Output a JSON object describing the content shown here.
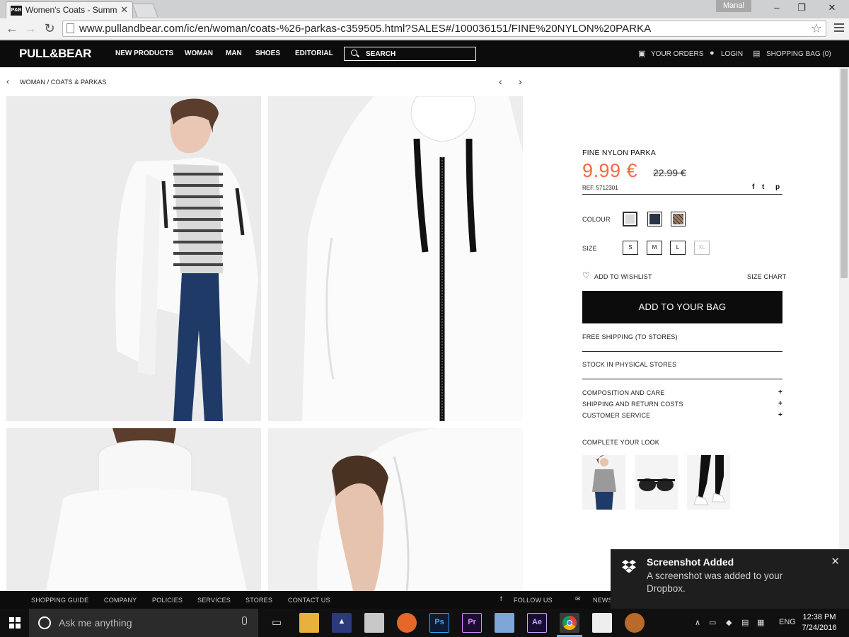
{
  "browser": {
    "tab_title": "Women's Coats - Summer",
    "tab_favicon_text": "P&B",
    "profile_name": "Manal",
    "url": "www.pullandbear.com/ic/en/woman/coats-%26-parkas-c359505.html?SALES#/100036151/FINE%20NYLON%20PARKA"
  },
  "header": {
    "logo": "PULL&BEAR",
    "nav": [
      "NEW PRODUCTS",
      "WOMAN",
      "MAN",
      "SHOES",
      "EDITORIAL"
    ],
    "search_label": "SEARCH",
    "orders": "YOUR ORDERS",
    "login": "LOGIN",
    "bag": "SHOPPING BAG (0)"
  },
  "breadcrumb": {
    "level1": "WOMAN",
    "separator": "/",
    "level2": "COATS & PARKAS"
  },
  "product": {
    "name": "FINE NYLON PARKA",
    "price": "9.99 €",
    "old_price": "22.99 €",
    "ref": "REF. 5712301",
    "social": [
      "f",
      "t",
      "p"
    ],
    "colour_label": "COLOUR",
    "colours": [
      "#d8d8d8",
      "#2b3347",
      "#9b7f6a"
    ],
    "size_label": "SIZE",
    "sizes": [
      "S",
      "M",
      "L",
      "XL"
    ],
    "wishlist": "ADD TO WISHLIST",
    "size_chart": "SIZE CHART",
    "add_to_bag": "ADD TO YOUR BAG",
    "free_shipping": "FREE SHIPPING (TO STORES)",
    "stock": "STOCK IN PHYSICAL STORES",
    "accordion": [
      "COMPOSITION AND CARE",
      "SHIPPING AND RETURN COSTS",
      "CUSTOMER SERVICE"
    ],
    "accordion_symbol": "+",
    "complete_look": "COMPLETE YOUR LOOK"
  },
  "footer": {
    "items": [
      "SHOPPING GUIDE",
      "COMPANY",
      "POLICIES",
      "SERVICES",
      "STORES",
      "CONTACT US"
    ],
    "follow": "FOLLOW US",
    "news": "NEWS"
  },
  "toast": {
    "title": "Screenshot Added",
    "body": "A screenshot was added to your Dropbox."
  },
  "taskbar": {
    "search_placeholder": "Ask me anything",
    "apps": [
      "Ps",
      "Pr",
      "Ae"
    ],
    "language": "ENG",
    "time": "12:38 PM",
    "date": "7/24/2016"
  },
  "colors": {
    "accent_price": "#f26b47",
    "header_bg": "#0c0c0c"
  }
}
